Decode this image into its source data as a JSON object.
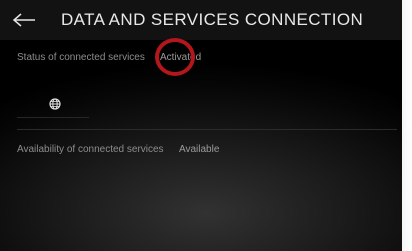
{
  "header": {
    "title": "DATA AND SERVICES CONNECTION",
    "back_icon": "arrow-left-icon"
  },
  "status_row": {
    "label": "Status of connected services",
    "value": "Activated",
    "highlight_color": "#b3161b"
  },
  "connectivity": {
    "icon": "globe-icon"
  },
  "availability_row": {
    "label": "Availability of connected services",
    "value": "Available"
  }
}
